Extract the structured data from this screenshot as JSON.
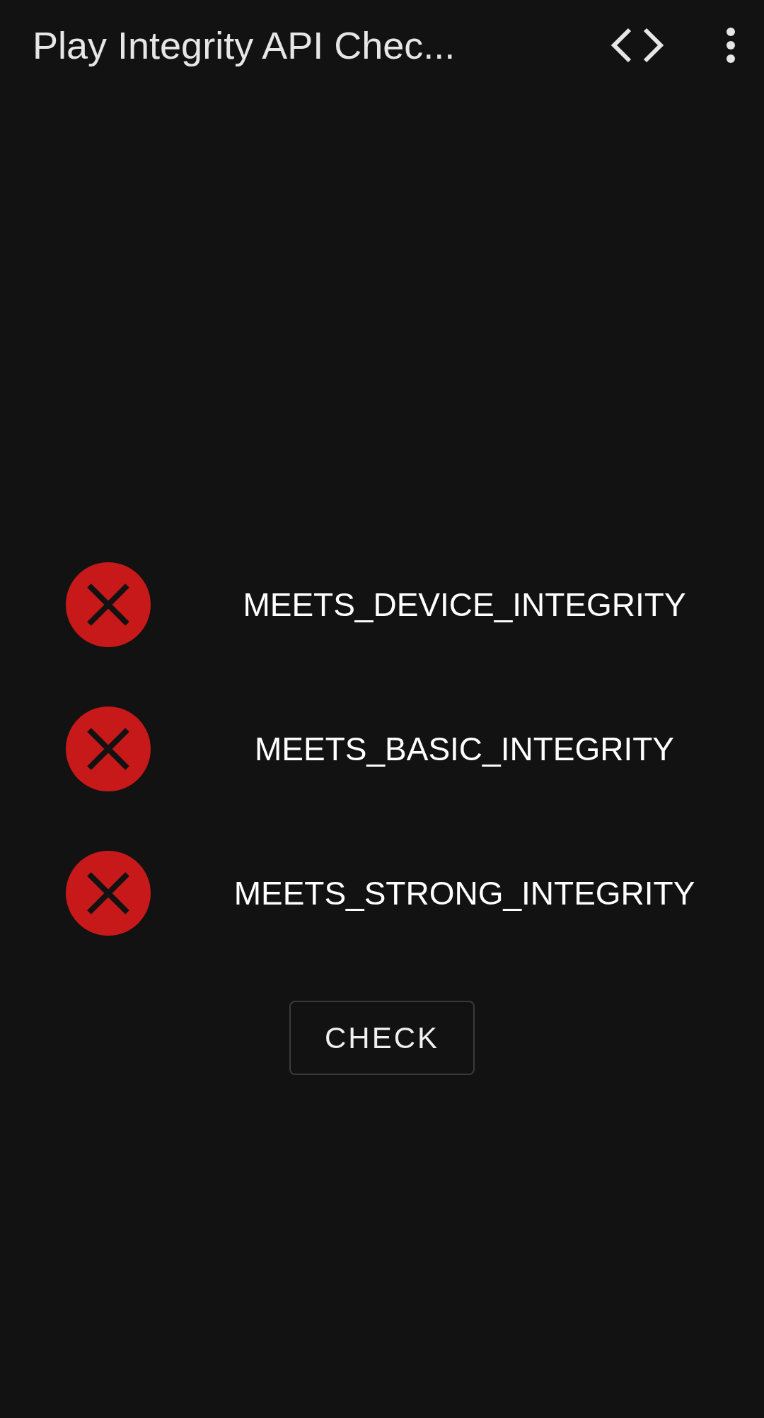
{
  "app_bar": {
    "title": "Play Integrity API Chec..."
  },
  "checks": [
    {
      "label": "MEETS_DEVICE_INTEGRITY",
      "passed": false
    },
    {
      "label": "MEETS_BASIC_INTEGRITY",
      "passed": false
    },
    {
      "label": "MEETS_STRONG_INTEGRITY",
      "passed": false
    }
  ],
  "button": "CHECK"
}
